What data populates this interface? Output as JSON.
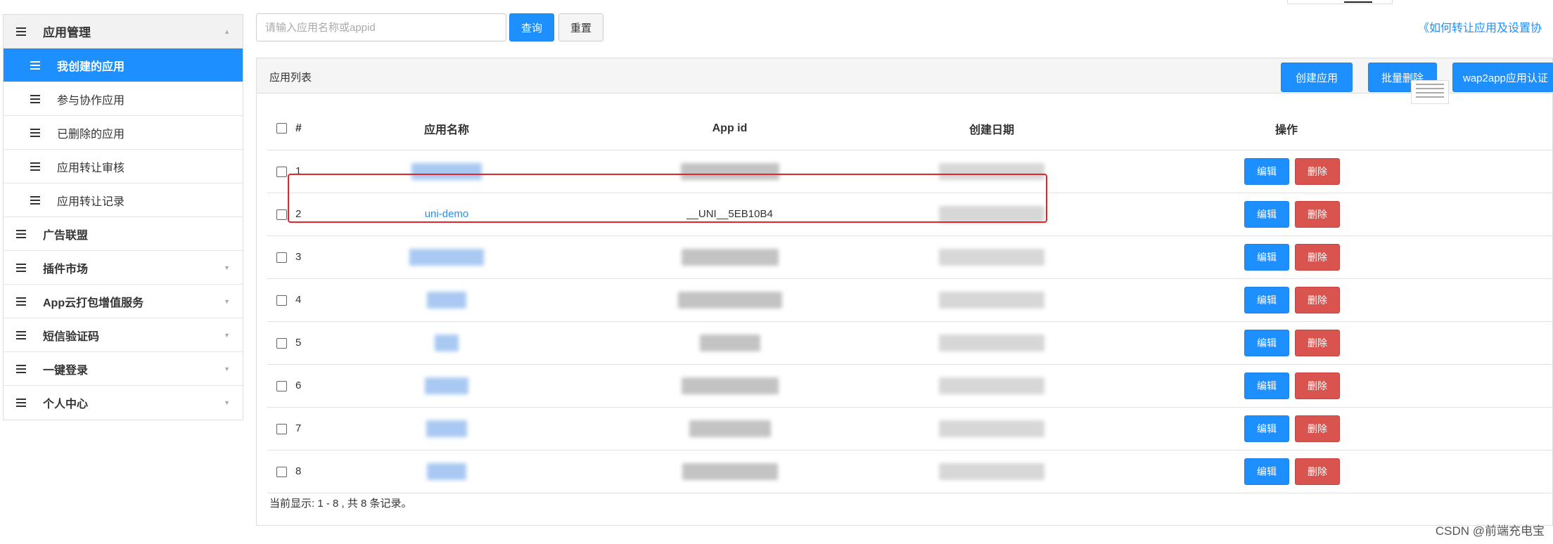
{
  "sidebar": {
    "group": {
      "label": "应用管理"
    },
    "sub_items": [
      {
        "label": "我创建的应用",
        "active": true
      },
      {
        "label": "参与协作应用"
      },
      {
        "label": "已删除的应用"
      },
      {
        "label": "应用转让审核"
      },
      {
        "label": "应用转让记录"
      }
    ],
    "items": [
      {
        "label": "广告联盟",
        "has_caret": false
      },
      {
        "label": "插件市场",
        "has_caret": true
      },
      {
        "label": "App云打包增值服务",
        "has_caret": true
      },
      {
        "label": "短信验证码",
        "has_caret": true
      },
      {
        "label": "一键登录",
        "has_caret": true
      },
      {
        "label": "个人中心",
        "has_caret": true
      }
    ]
  },
  "search": {
    "placeholder": "请输入应用名称或appid",
    "query_label": "查询",
    "reset_label": "重置"
  },
  "help_link": "《如何转让应用及设置协",
  "panel": {
    "title": "应用列表",
    "create_label": "创建应用",
    "batch_delete_label": "批量删除",
    "wap2app_label": "wap2app应用认证"
  },
  "table": {
    "headers": [
      "#",
      "应用名称",
      "App id",
      "创建日期",
      "操作"
    ],
    "rows": [
      {
        "num": "1",
        "name": "",
        "appid": "",
        "date": ""
      },
      {
        "num": "2",
        "name": "uni-demo",
        "appid": "__UNI__5EB10B4",
        "date": ""
      },
      {
        "num": "3",
        "name": "",
        "appid": "",
        "date": ""
      },
      {
        "num": "4",
        "name": "",
        "appid": "",
        "date": ""
      },
      {
        "num": "5",
        "name": "",
        "appid": "",
        "date": ""
      },
      {
        "num": "6",
        "name": "",
        "appid": "",
        "date": ""
      },
      {
        "num": "7",
        "name": "",
        "appid": "",
        "date": ""
      },
      {
        "num": "8",
        "name": "",
        "appid": "",
        "date": ""
      }
    ],
    "edit_label": "编辑",
    "delete_label": "删除"
  },
  "footer_info": "当前显示: 1 - 8 , 共 8 条记录。",
  "watermark": "CSDN @前端充电宝",
  "colors": {
    "primary": "#1e8fff",
    "danger": "#d9534f",
    "highlight": "#e6252a"
  }
}
